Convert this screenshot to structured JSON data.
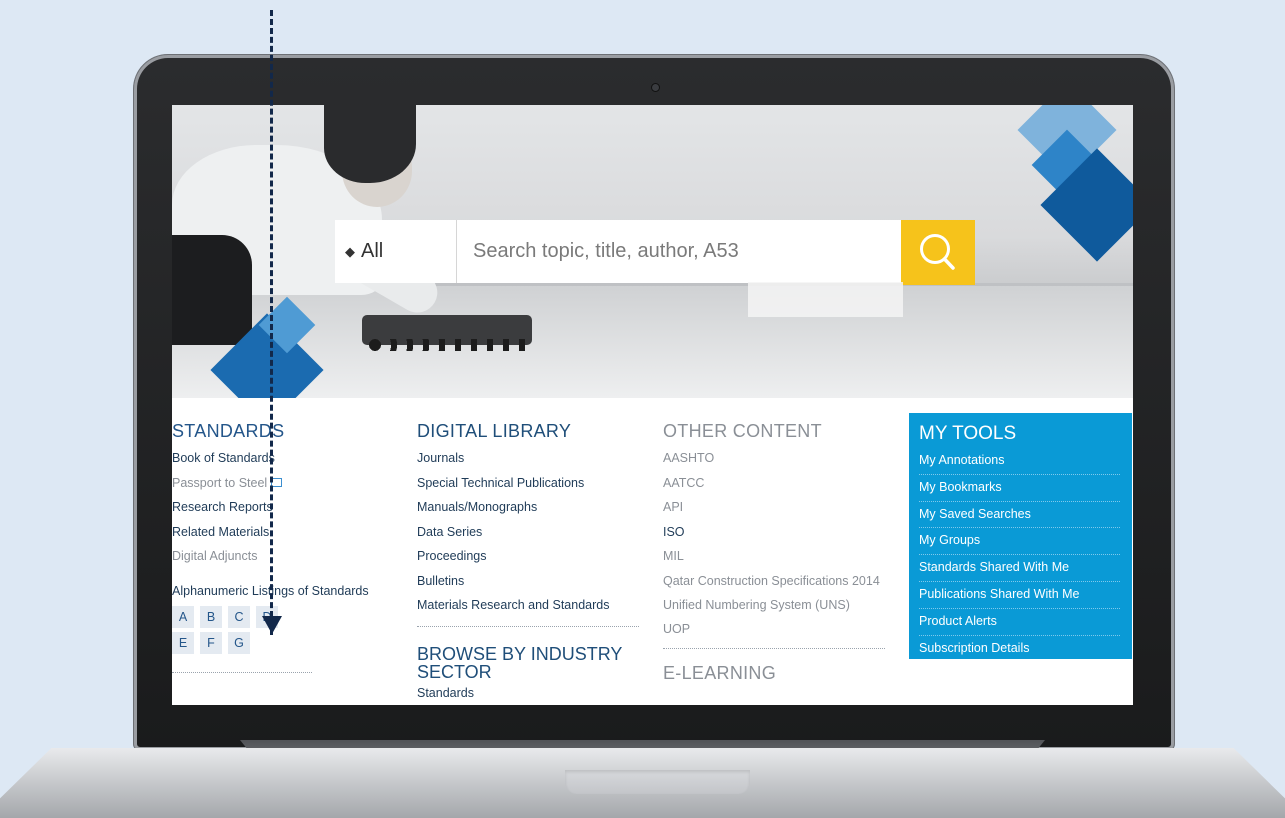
{
  "search": {
    "scope_label": "All",
    "placeholder": "Search topic, title, author, A53"
  },
  "standards": {
    "heading": "STANDARDS",
    "links": [
      "Book of Standards",
      "Passport to Steel",
      "Research Reports",
      "Related Materials",
      "Digital Adjuncts"
    ],
    "alphanumeric_label": "Alphanumeric Listings of Standards",
    "letters": [
      "A",
      "B",
      "C",
      "D",
      "E",
      "F",
      "G"
    ]
  },
  "digital_library": {
    "heading": "DIGITAL LIBRARY",
    "links": [
      "Journals",
      "Special Technical Publications",
      "Manuals/Monographs",
      "Data Series",
      "Proceedings",
      "Bulletins",
      "Materials Research and Standards"
    ]
  },
  "browse": {
    "heading": "BROWSE BY INDUSTRY SECTOR",
    "links": [
      "Standards"
    ]
  },
  "other_content": {
    "heading": "OTHER CONTENT",
    "links": [
      "AASHTO",
      "AATCC",
      "API",
      "ISO",
      "MIL",
      "Qatar Construction Specifications 2014",
      "Unified Numbering System (UNS)",
      "UOP"
    ]
  },
  "elearning": {
    "heading": "E-LEARNING"
  },
  "my_tools": {
    "heading": "MY TOOLS",
    "links": [
      "My Annotations",
      "My Bookmarks",
      "My Saved Searches",
      "My Groups",
      "Standards Shared With Me",
      "Publications Shared With Me",
      "Product Alerts",
      "Subscription Details"
    ]
  },
  "colors": {
    "accent_yellow": "#f6c31b",
    "tools_blue": "#0a9ad6",
    "heading_navy": "#1f4e79",
    "muted_gray": "#8a8f96"
  }
}
